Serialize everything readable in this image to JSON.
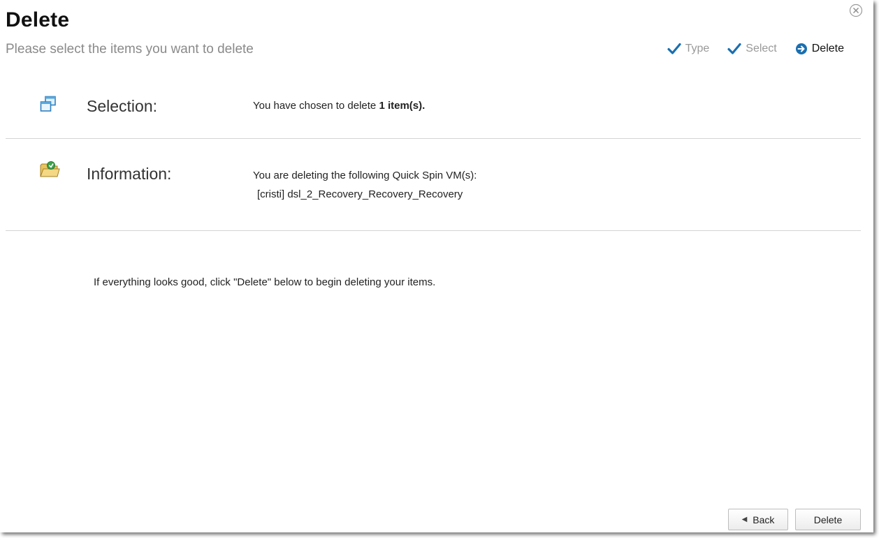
{
  "dialog": {
    "title": "Delete",
    "subtitle": "Please select the items you want to delete",
    "close_icon": "close-circle-icon"
  },
  "steps": [
    {
      "label": "Type",
      "state": "done",
      "icon": "checkmark-icon"
    },
    {
      "label": "Select",
      "state": "done",
      "icon": "checkmark-icon"
    },
    {
      "label": "Delete",
      "state": "current",
      "icon": "arrow-circle-icon"
    }
  ],
  "selection": {
    "label": "Selection:",
    "icon": "windows-stack-icon",
    "text_prefix": "You have chosen to delete ",
    "text_bold": "1 item(s)."
  },
  "information": {
    "label": "Information:",
    "icon": "folder-icon",
    "line1": "You are deleting the following Quick Spin VM(s):",
    "line2": "[cristi] dsl_2_Recovery_Recovery_Recovery"
  },
  "hint": "If everything looks good, click \"Delete\" below to begin deleting your items.",
  "buttons": {
    "back_label": "Back",
    "delete_label": "Delete"
  },
  "colors": {
    "accent": "#1a6fb0",
    "muted_text": "#8a8a8a",
    "divider": "#d4d4d4"
  }
}
